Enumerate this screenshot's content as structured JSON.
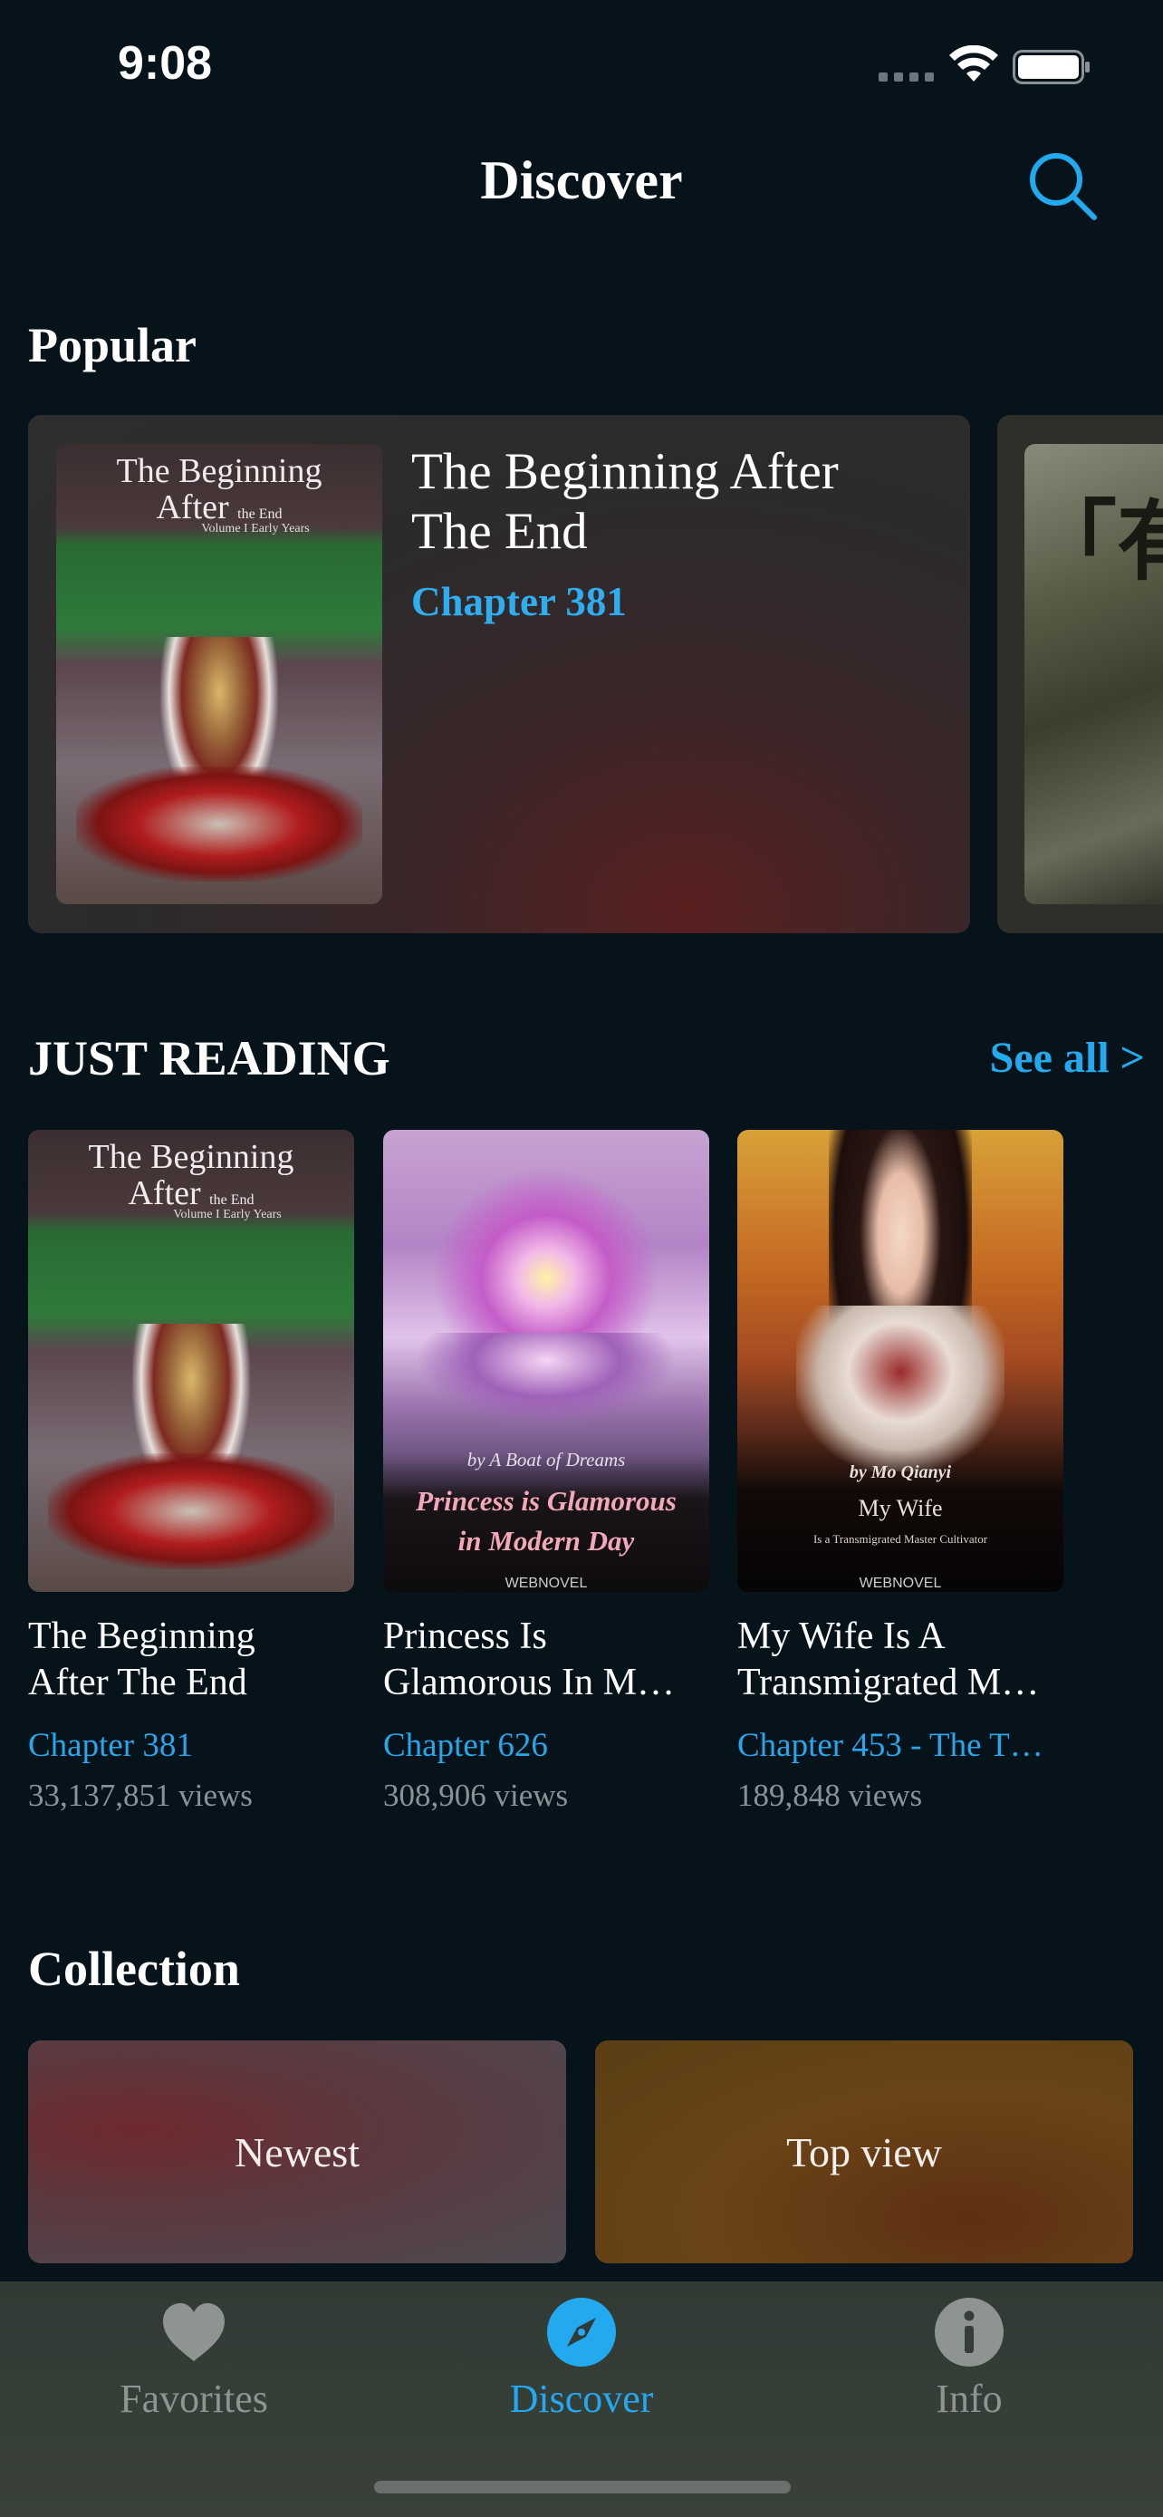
{
  "status_bar": {
    "time": "9:08"
  },
  "header": {
    "title": "Discover"
  },
  "popular": {
    "section_title": "Popular",
    "card": {
      "title": "The Beginning After The End",
      "chapter": "Chapter 381"
    }
  },
  "just_reading": {
    "section_title": "JUST READING",
    "see_all_label": "See all >",
    "items": [
      {
        "title_line1": "The Beginning",
        "title_line2": "After The End",
        "chapter": "Chapter 381",
        "views": "33,137,851 views",
        "cover_title_line1": "The Beginning",
        "cover_title_line2": "After",
        "cover_title_suffix": "the End",
        "cover_subtitle": "Volume I Early Years"
      },
      {
        "title_line1": "Princess Is",
        "title_line2": "Glamorous In M…",
        "chapter": "Chapter 626",
        "views": "308,906 views",
        "cover_author": "by A Boat of Dreams",
        "cover_title_line1": "Princess is Glamorous",
        "cover_title_line2": "in Modern Day",
        "cover_publisher": "WEBNOVEL"
      },
      {
        "title_line1": "My Wife Is A",
        "title_line2": "Transmigrated M…",
        "chapter": "Chapter 453 - The T…",
        "views": "189,848 views",
        "cover_author": "by Mo Qianyi",
        "cover_title": "My Wife",
        "cover_subtitle": "Is a Transmigrated Master Cultivator",
        "cover_publisher": "WEBNOVEL"
      }
    ]
  },
  "collection": {
    "section_title": "Collection",
    "cards": [
      {
        "label": "Newest"
      },
      {
        "label": "Top view"
      }
    ]
  },
  "tab_bar": {
    "items": [
      {
        "label": "Favorites",
        "icon": "heart-icon",
        "active": false
      },
      {
        "label": "Discover",
        "icon": "compass-icon",
        "active": true
      },
      {
        "label": "Info",
        "icon": "info-icon",
        "active": false
      }
    ]
  },
  "colors": {
    "background": "#06131b",
    "accent": "#23a9ef",
    "muted_text": "#8a9298",
    "tab_bar": "#343d37"
  }
}
